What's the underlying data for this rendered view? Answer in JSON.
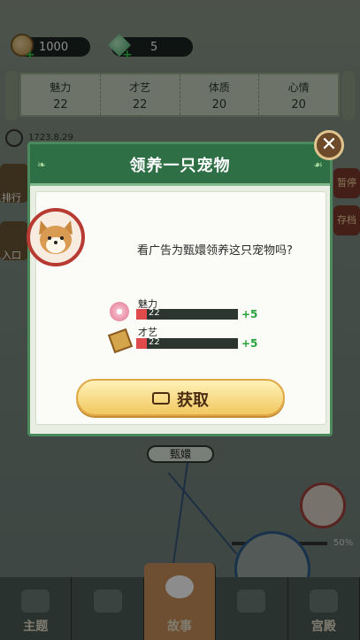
{
  "resources": {
    "coins": "1000",
    "gems": "5"
  },
  "stats": [
    {
      "label": "魅力",
      "value": "22"
    },
    {
      "label": "才艺",
      "value": "22"
    },
    {
      "label": "体质",
      "value": "20"
    },
    {
      "label": "心情",
      "value": "20"
    }
  ],
  "background": {
    "date": "1723.8.29",
    "side_left": [
      "排行",
      "入口"
    ],
    "side_right": [
      "暂停",
      "存档"
    ],
    "node_label": "甄嬛",
    "zoom_pct": "50%"
  },
  "dialog": {
    "title": "领养一只宠物",
    "question": "看广告为甄嬛领养这只宠物吗?",
    "attributes": [
      {
        "name": "魅力",
        "value": "22",
        "gain": "+5",
        "icon": "flower-icon"
      },
      {
        "name": "才艺",
        "value": "22",
        "gain": "+5",
        "icon": "book-icon"
      }
    ],
    "button_label": "获取",
    "close_symbol": "✕"
  },
  "nav": [
    {
      "label": "主题"
    },
    {
      "label": ""
    },
    {
      "label": "故事"
    },
    {
      "label": ""
    },
    {
      "label": "宫殿"
    }
  ],
  "colors": {
    "dialog_header": "#2f6f45",
    "accent_green": "#28a23a",
    "bar_fill": "#e14a4a"
  }
}
